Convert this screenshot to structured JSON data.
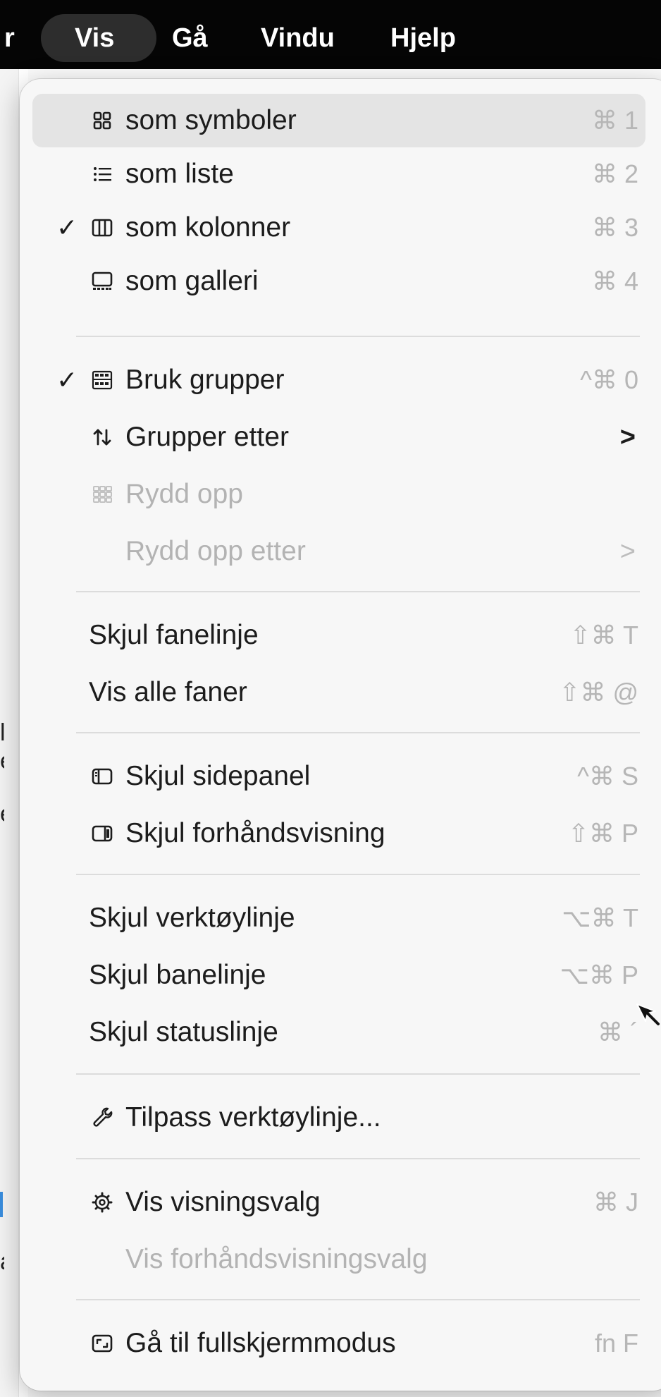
{
  "menubar": {
    "items": [
      {
        "label": "r"
      },
      {
        "label": "Vis",
        "active": true
      },
      {
        "label": "Gå"
      },
      {
        "label": "Vindu"
      },
      {
        "label": "Hjelp"
      }
    ]
  },
  "menu": {
    "items": [
      {
        "label": "som symboler",
        "icon": "grid-icon",
        "shortcut": "⌘ 1",
        "checked": false,
        "enabled": true,
        "hovered": true
      },
      {
        "label": "som liste",
        "icon": "list-icon",
        "shortcut": "⌘ 2",
        "checked": false,
        "enabled": true
      },
      {
        "label": "som kolonner",
        "icon": "columns-icon",
        "shortcut": "⌘ 3",
        "checked": true,
        "enabled": true
      },
      {
        "label": "som galleri",
        "icon": "gallery-icon",
        "shortcut": "⌘ 4",
        "checked": false,
        "enabled": true
      },
      {
        "label": "Bruk grupper",
        "icon": "groups-icon",
        "shortcut": "^⌘ 0",
        "checked": true,
        "enabled": true
      },
      {
        "label": "Grupper etter",
        "icon": "sort-arrows-icon",
        "submenu": true,
        "checked": false,
        "enabled": true
      },
      {
        "label": "Rydd opp",
        "icon": "cleanup-grid-icon",
        "checked": false,
        "enabled": false
      },
      {
        "label": "Rydd opp etter",
        "submenu": true,
        "checked": false,
        "enabled": false
      },
      {
        "label": "Skjul fanelinje",
        "shortcut": "⇧⌘ T",
        "enabled": true
      },
      {
        "label": "Vis alle faner",
        "shortcut": "⇧⌘ @",
        "enabled": true
      },
      {
        "label": "Skjul sidepanel",
        "icon": "sidebar-icon",
        "shortcut": "^⌘ S",
        "enabled": true
      },
      {
        "label": "Skjul forhåndsvisning",
        "icon": "preview-pane-icon",
        "shortcut": "⇧⌘ P",
        "enabled": true
      },
      {
        "label": "Skjul verktøylinje",
        "shortcut": "⌥⌘ T",
        "enabled": true
      },
      {
        "label": "Skjul banelinje",
        "shortcut": "⌥⌘ P",
        "enabled": true
      },
      {
        "label": "Skjul statuslinje",
        "shortcut": "⌘ ´",
        "enabled": true
      },
      {
        "label": "Tilpass verktøylinje...",
        "icon": "wrench-icon",
        "enabled": true
      },
      {
        "label": "Vis visningsvalg",
        "icon": "gear-icon",
        "shortcut": "⌘ J",
        "enabled": true
      },
      {
        "label": "Vis forhåndsvisningsvalg",
        "enabled": false
      },
      {
        "label": "Gå til fullskjermmodus",
        "icon": "fullscreen-icon",
        "shortcut": "fn F",
        "enabled": true
      }
    ]
  },
  "check_glyph": "✓",
  "submenu_glyph": ">",
  "background_fragments": [
    "e",
    "e",
    "a",
    "l"
  ]
}
